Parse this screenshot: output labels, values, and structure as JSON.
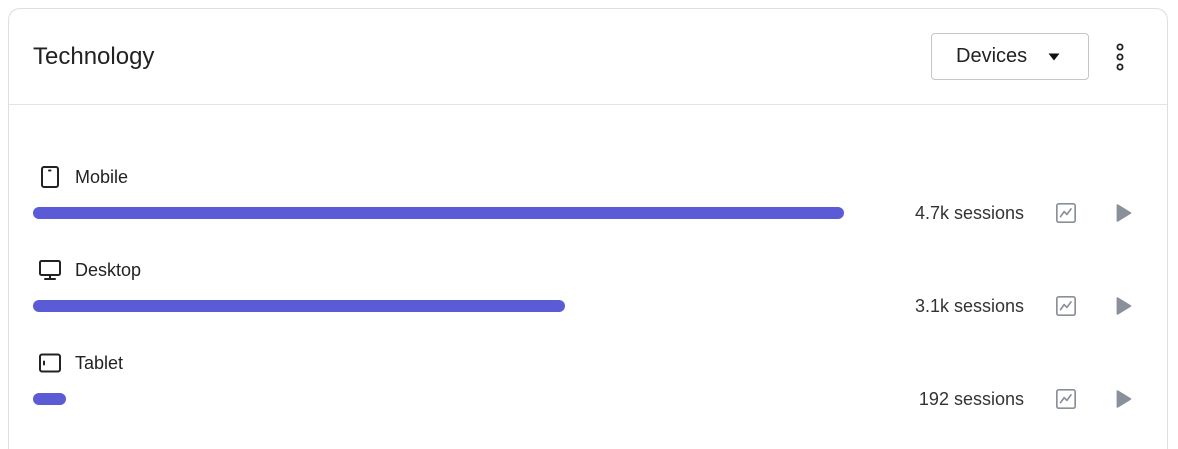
{
  "card": {
    "title": "Technology",
    "dropdown": {
      "selected": "Devices",
      "icon": "caret-down-icon"
    },
    "menu_icon": "kebab-menu-icon"
  },
  "colors": {
    "bar": "#5b5bd6",
    "action_icon": "#8a9099",
    "text": "#222222"
  },
  "rows": [
    {
      "label": "Mobile",
      "icon": "mobile-icon",
      "sessions": "4.7k sessions",
      "fill": 1.0
    },
    {
      "label": "Desktop",
      "icon": "desktop-icon",
      "sessions": "3.1k sessions",
      "fill": 0.656
    },
    {
      "label": "Tablet",
      "icon": "tablet-icon",
      "sessions": "192 sessions",
      "fill": 0.041
    }
  ],
  "row_actions": {
    "chart_icon": "line-chart-icon",
    "play_icon": "play-icon"
  }
}
